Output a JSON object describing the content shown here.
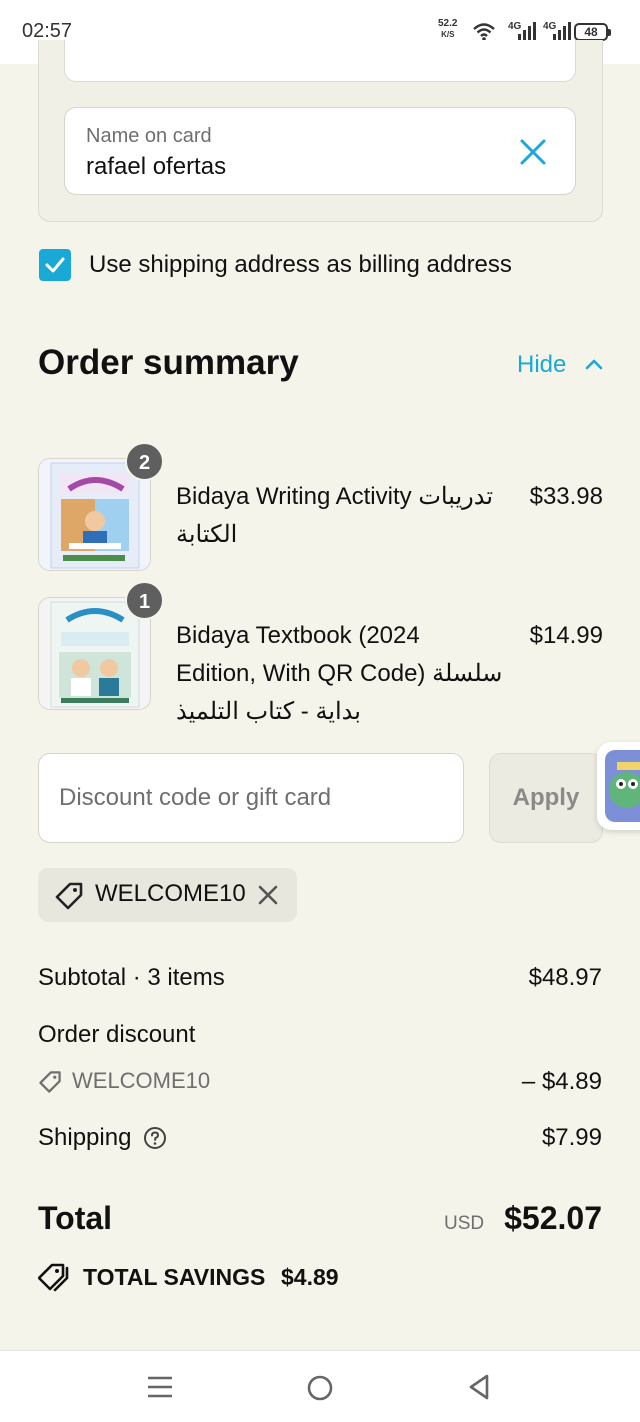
{
  "status_bar": {
    "time": "02:57",
    "net_speed_value": "52.2",
    "net_speed_unit": "K/S",
    "network_1": "4G",
    "network_2": "4G",
    "battery": "48"
  },
  "card_form": {
    "name_label": "Name on card",
    "name_value": "rafael ofertas"
  },
  "billing": {
    "checkbox_label": "Use shipping address as billing address",
    "checked": true
  },
  "order_summary": {
    "title": "Order summary",
    "toggle_label": "Hide",
    "items": [
      {
        "quantity": "2",
        "title": "Bidaya Writing Activity تدريبات الكتابة",
        "price": "$33.98"
      },
      {
        "quantity": "1",
        "title": "Bidaya Textbook (2024 Edition, With QR Code) سلسلة بداية - كتاب التلميذ",
        "price": "$14.99"
      }
    ]
  },
  "discount": {
    "placeholder": "Discount code or gift card",
    "apply_label": "Apply",
    "applied_code": "WELCOME10"
  },
  "totals": {
    "subtotal_label": "Subtotal · 3 items",
    "subtotal_value": "$48.97",
    "discount_label": "Order discount",
    "discount_code": "WELCOME10",
    "discount_value": "– $4.89",
    "shipping_label": "Shipping",
    "shipping_value": "$7.99",
    "total_label": "Total",
    "currency": "USD",
    "total_value": "$52.07",
    "savings_label": "TOTAL SAVINGS",
    "savings_value": "$4.89"
  },
  "colors": {
    "accent": "#1aa9d6",
    "background": "#f5f4ea",
    "badge": "#5f5f5f"
  },
  "icons": {
    "clear": "close-icon",
    "checkbox": "checkmark-icon",
    "toggle": "chevron-up-icon",
    "tag": "tag-icon",
    "remove_code": "close-icon",
    "help": "help-circle-icon",
    "savings": "tags-icon",
    "nav": [
      "menu-icon",
      "home-circle-icon",
      "back-triangle-icon"
    ]
  }
}
